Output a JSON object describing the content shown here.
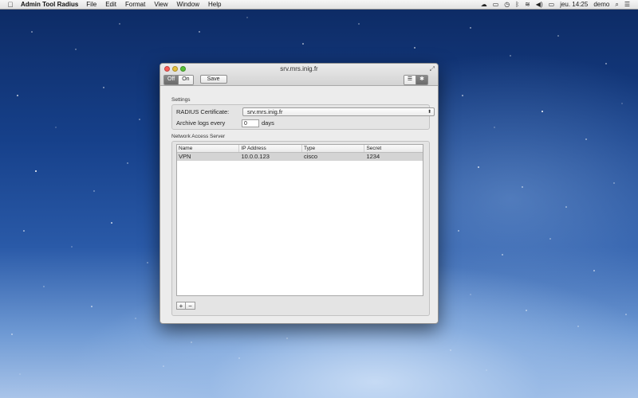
{
  "menubar": {
    "app_name": "Admin Tool Radius",
    "menus": [
      "File",
      "Edit",
      "Format",
      "View",
      "Window",
      "Help"
    ],
    "clock": "jeu. 14:25",
    "user": "demo"
  },
  "window": {
    "title": "srv.mrs.inig.fr",
    "toolbar": {
      "off_label": "Off",
      "on_label": "On",
      "save_label": "Save"
    }
  },
  "settings": {
    "section_label": "Settings",
    "certificate_label": "RADIUS Certificate:",
    "certificate_value": "srv.mrs.inig.fr",
    "archive_label": "Archive logs every",
    "archive_value": "0",
    "archive_unit": "days"
  },
  "nas": {
    "section_label": "Network Access Server",
    "columns": [
      "Name",
      "IP Address",
      "Type",
      "Secret"
    ],
    "rows": [
      [
        "VPN",
        "10.0.0.123",
        "cisco",
        "1234"
      ]
    ],
    "add_label": "+",
    "remove_label": "−"
  },
  "colors": {
    "toggle_active": "#7a7a7a",
    "selected_row": "#d4d4d4"
  }
}
